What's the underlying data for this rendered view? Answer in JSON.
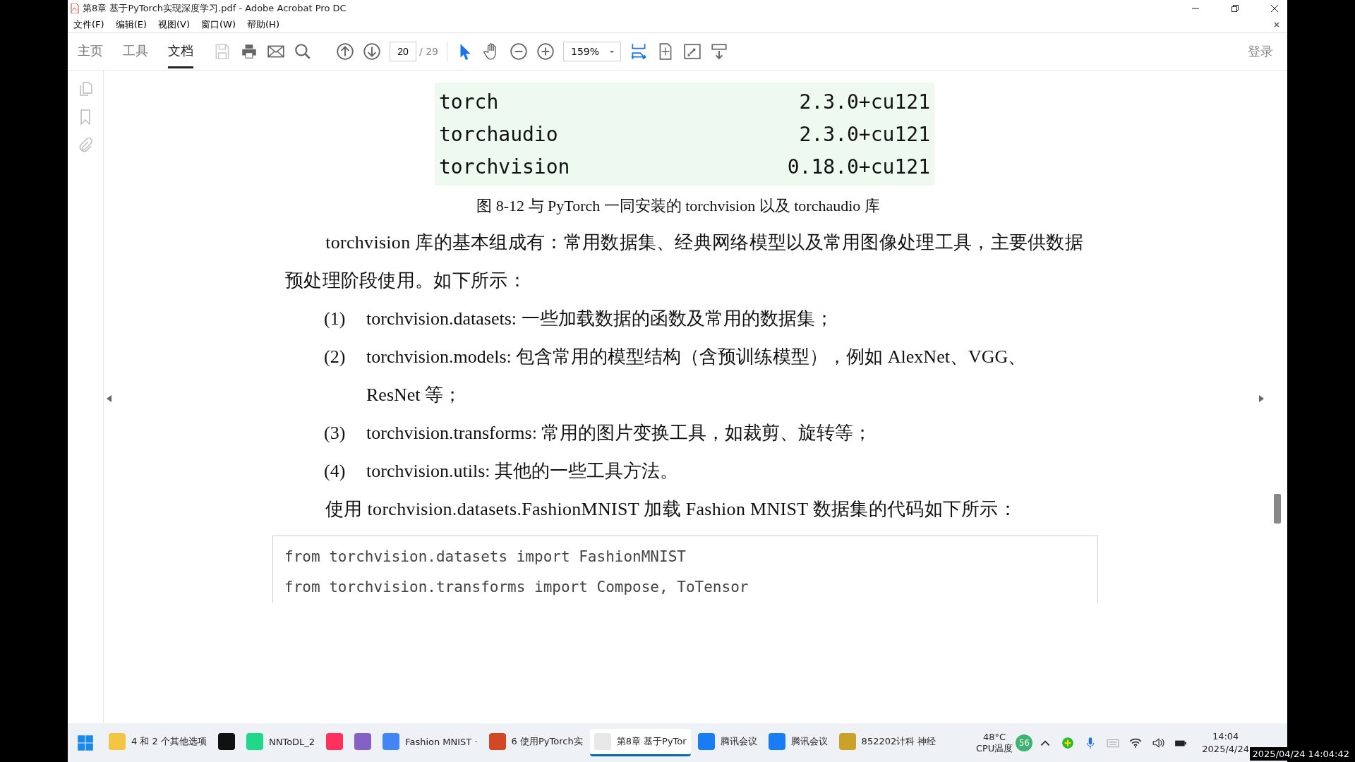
{
  "window": {
    "title": "第8章 基于PyTorch实现深度学习.pdf - Adobe Acrobat Pro DC"
  },
  "menu": [
    "文件(F)",
    "编辑(E)",
    "视图(V)",
    "窗口(W)",
    "帮助(H)"
  ],
  "tabs": [
    {
      "label": "主页",
      "selected": false
    },
    {
      "label": "工具",
      "selected": false
    },
    {
      "label": "文档",
      "selected": true
    }
  ],
  "toolbar": {
    "page": "20",
    "page_count": "/ 29",
    "zoom": "159%",
    "login": "登录"
  },
  "document": {
    "table": [
      {
        "name": "torch",
        "version": "2.3.0+cu121"
      },
      {
        "name": "torchaudio",
        "version": "2.3.0+cu121"
      },
      {
        "name": "torchvision",
        "version": "0.18.0+cu121"
      }
    ],
    "caption": "图 8-12  与 PyTorch 一同安装的 torchvision 以及 torchaudio 库",
    "paragraph": "torchvision 库的基本组成有：常用数据集、经典网络模型以及常用图像处理工具，主要供数据预处理阶段使用。如下所示：",
    "list": [
      {
        "number": "(1)",
        "text": "torchvision.datasets: 一些加载数据的函数及常用的数据集；"
      },
      {
        "number": "(2)",
        "text": "torchvision.models: 包含常用的模型结构（含预训练模型），例如 AlexNet、VGG、ResNet 等；"
      },
      {
        "number": "(3)",
        "text": "torchvision.transforms: 常用的图片变换工具，如裁剪、旋转等；"
      },
      {
        "number": "(4)",
        "text": "torchvision.utils: 其他的一些工具方法。"
      }
    ],
    "intro": "使用 torchvision.datasets.FashionMNIST 加载 Fashion MNIST 数据集的代码如下所示：",
    "code": [
      "from torchvision.datasets import FashionMNIST",
      "from torchvision.transforms import Compose, ToTensor"
    ]
  },
  "taskbar": {
    "items": [
      {
        "kind": "folder",
        "label": "4 和 2 个其他选项",
        "selected": false
      },
      {
        "kind": "terminal",
        "selected": false
      },
      {
        "kind": "pycharm",
        "label": "NNToDL_2",
        "selected": false
      },
      {
        "kind": "idea",
        "selected": false
      },
      {
        "kind": "vs",
        "selected": false
      },
      {
        "kind": "chrome",
        "label": "Fashion MNIST ·",
        "selected": false
      },
      {
        "kind": "ppt",
        "label": "6 使用PyTorch实",
        "selected": false
      },
      {
        "kind": "pdf",
        "label": "第8章 基于PyTor",
        "selected": true
      },
      {
        "kind": "meeting",
        "label": "腾讯会议",
        "selected": false
      },
      {
        "kind": "meeting",
        "label": "腾讯会议",
        "selected": false
      },
      {
        "kind": "app",
        "label": "852202计科 神经",
        "selected": false
      }
    ],
    "temperature": "48°C",
    "temperature_label": "CPU温度",
    "badge": "56",
    "time": "14:04",
    "date": "2025/4/24"
  },
  "timestamp": "2025/04/24 14:04:42"
}
